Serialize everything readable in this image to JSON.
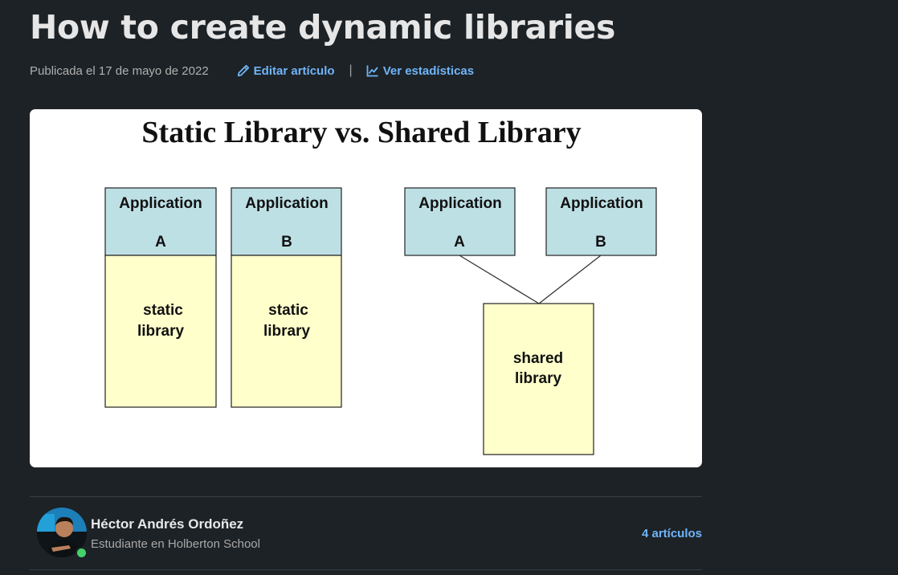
{
  "article": {
    "title": "How to create dynamic libraries",
    "published": "Publicada el 17 de mayo de 2022",
    "edit_label": "Editar artículo",
    "separator": "|",
    "stats_label": "Ver estadísticas"
  },
  "figure": {
    "heading": "Static Library vs. Shared Library",
    "static_a": {
      "app": "Application",
      "letter": "A",
      "lib_line1": "static",
      "lib_line2": "library"
    },
    "static_b": {
      "app": "Application",
      "letter": "B",
      "lib_line1": "static",
      "lib_line2": "library"
    },
    "shared_a": {
      "app": "Application",
      "letter": "A"
    },
    "shared_b": {
      "app": "Application",
      "letter": "B"
    },
    "shared_lib": {
      "line1": "shared",
      "line2": "library"
    }
  },
  "author": {
    "name": "Héctor Andrés Ordoñez",
    "role": "Estudiante en Holberton School",
    "articles": "4 artículos"
  },
  "colors": {
    "background": "#1d2226",
    "link": "#70b5f9",
    "app_box": "#bde0e5",
    "lib_box": "#ffffcc",
    "presence": "#44d16b"
  },
  "icons": {
    "edit": "pencil-icon",
    "stats": "line-chart-icon",
    "status": "online-status-icon"
  }
}
